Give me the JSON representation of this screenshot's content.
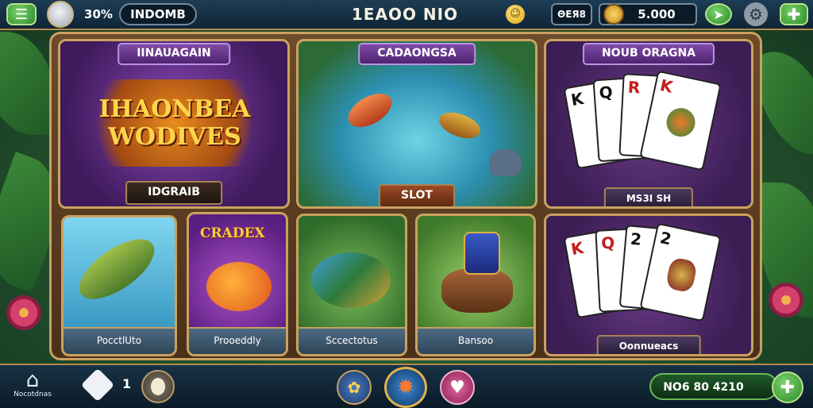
{
  "topbar": {
    "percent": "30%",
    "username": "INDOMB",
    "title": "1EAOO NIO",
    "currency_label": "ΘEЯ8",
    "coins": "5.000",
    "icons": [
      "menu-icon",
      "avatar-icon",
      "smiley-icon",
      "coin-icon",
      "arrow-icon",
      "gear-icon",
      "plus-icon"
    ]
  },
  "panels": {
    "featured": {
      "banner": "IINAUAGAIN",
      "logo_line1": "IHAONBEA",
      "logo_line2": "WODIVES",
      "plaque": "IDGRAIB"
    },
    "fishing": {
      "banner": "CADAONGSA",
      "plaque": "SLOT"
    },
    "cards_top": {
      "banner": "NOUB ORAGNA",
      "plaque": "MS3I SH"
    },
    "small": [
      {
        "label": "PocctlUto"
      },
      {
        "label": "Prooeddly",
        "title": "CRADEX"
      },
      {
        "label": "Sccectotus"
      },
      {
        "label": "Bansoo"
      }
    ],
    "cards_bottom": {
      "plaque": "Oonnueacs"
    }
  },
  "cards_top_ranks": [
    "K",
    "Q",
    "R",
    "K"
  ],
  "cards_bottom_ranks": [
    "K",
    "Q",
    "2",
    "2"
  ],
  "bottombar": {
    "home_label": "Nocotdnas",
    "count": "1",
    "balance": "NO6 80 4210",
    "icons": [
      "home-icon",
      "diamond-icon",
      "egg-icon",
      "palette-icon",
      "star-wheel-icon",
      "heart-icon",
      "plus-icon"
    ]
  },
  "colors": {
    "accent_gold": "#c9a062",
    "panel_purple": "#5a2d7c",
    "button_green": "#3a9a36"
  }
}
